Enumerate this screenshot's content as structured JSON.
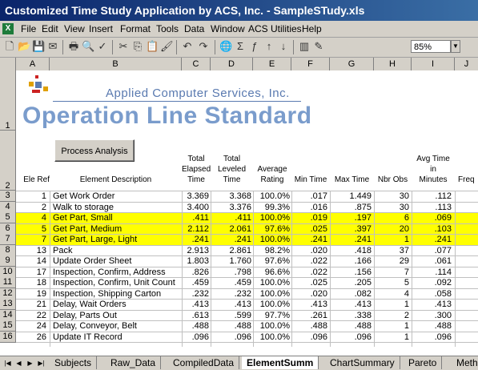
{
  "window": {
    "title": "Customized Time Study Application by ACS, Inc. - SampleSTudy.xls"
  },
  "menu": [
    "File",
    "Edit",
    "View",
    "Insert",
    "Format",
    "Tools",
    "Data",
    "Window",
    "ACS Utilities",
    "Help"
  ],
  "toolbar": {
    "zoom": "85%"
  },
  "columns": [
    "A",
    "B",
    "C",
    "D",
    "E",
    "F",
    "G",
    "H",
    "I",
    "J"
  ],
  "sheet": {
    "company": "Applied Computer Services, Inc.",
    "title": "Operation Line Standard",
    "button_label": "Process Analysis",
    "headers": {
      "ele_ref": "Ele Ref",
      "desc": "Element Description",
      "total_elapsed": "Total Elapsed Time",
      "total_leveled": "Total Leveled Time",
      "avg_rating": "Average Rating",
      "min_time": "Min Time",
      "max_time": "Max Time",
      "nbr_obs": "Nbr Obs",
      "avg_time": "Avg Time in Minutes",
      "freq": "Freq"
    },
    "rows": [
      {
        "row": "3",
        "ref": "1",
        "desc": "Get Work Order",
        "elapsed": "3.369",
        "leveled": "3.368",
        "rating": "100.0%",
        "min": ".017",
        "max": "1.449",
        "obs": "30",
        "avg": ".112",
        "highlight": false
      },
      {
        "row": "4",
        "ref": "2",
        "desc": "Walk to storage",
        "elapsed": "3.400",
        "leveled": "3.376",
        "rating": "99.3%",
        "min": ".016",
        "max": ".875",
        "obs": "30",
        "avg": ".113",
        "highlight": false
      },
      {
        "row": "5",
        "ref": "4",
        "desc": "Get Part, Small",
        "elapsed": ".411",
        "leveled": ".411",
        "rating": "100.0%",
        "min": ".019",
        "max": ".197",
        "obs": "6",
        "avg": ".069",
        "highlight": true
      },
      {
        "row": "6",
        "ref": "5",
        "desc": "Get Part, Medium",
        "elapsed": "2.112",
        "leveled": "2.061",
        "rating": "97.6%",
        "min": ".025",
        "max": ".397",
        "obs": "20",
        "avg": ".103",
        "highlight": true
      },
      {
        "row": "7",
        "ref": "7",
        "desc": "Get Part, Large, Light",
        "elapsed": ".241",
        "leveled": ".241",
        "rating": "100.0%",
        "min": ".241",
        "max": ".241",
        "obs": "1",
        "avg": ".241",
        "highlight": true
      },
      {
        "row": "8",
        "ref": "13",
        "desc": "Pack",
        "elapsed": "2.913",
        "leveled": "2.861",
        "rating": "98.2%",
        "min": ".020",
        "max": ".418",
        "obs": "37",
        "avg": ".077",
        "highlight": false
      },
      {
        "row": "9",
        "ref": "14",
        "desc": "Update Order Sheet",
        "elapsed": "1.803",
        "leveled": "1.760",
        "rating": "97.6%",
        "min": ".022",
        "max": ".166",
        "obs": "29",
        "avg": ".061",
        "highlight": false
      },
      {
        "row": "10",
        "ref": "17",
        "desc": "Inspection, Confirm, Address",
        "elapsed": ".826",
        "leveled": ".798",
        "rating": "96.6%",
        "min": ".022",
        "max": ".156",
        "obs": "7",
        "avg": ".114",
        "highlight": false
      },
      {
        "row": "11",
        "ref": "18",
        "desc": "Inspection, Confirm, Unit Count",
        "elapsed": ".459",
        "leveled": ".459",
        "rating": "100.0%",
        "min": ".025",
        "max": ".205",
        "obs": "5",
        "avg": ".092",
        "highlight": false
      },
      {
        "row": "12",
        "ref": "19",
        "desc": "Inspection, Shipping Carton",
        "elapsed": ".232",
        "leveled": ".232",
        "rating": "100.0%",
        "min": ".020",
        "max": ".082",
        "obs": "4",
        "avg": ".058",
        "highlight": false
      },
      {
        "row": "13",
        "ref": "21",
        "desc": "Delay, Wait Orders",
        "elapsed": ".413",
        "leveled": ".413",
        "rating": "100.0%",
        "min": ".413",
        "max": ".413",
        "obs": "1",
        "avg": ".413",
        "highlight": false
      },
      {
        "row": "14",
        "ref": "22",
        "desc": "Delay, Parts Out",
        "elapsed": ".613",
        "leveled": ".599",
        "rating": "97.7%",
        "min": ".261",
        "max": ".338",
        "obs": "2",
        "avg": ".300",
        "highlight": false
      },
      {
        "row": "15",
        "ref": "24",
        "desc": "Delay, Conveyor, Belt",
        "elapsed": ".488",
        "leveled": ".488",
        "rating": "100.0%",
        "min": ".488",
        "max": ".488",
        "obs": "1",
        "avg": ".488",
        "highlight": false
      },
      {
        "row": "16",
        "ref": "26",
        "desc": "Update IT Record",
        "elapsed": ".096",
        "leveled": ".096",
        "rating": "100.0%",
        "min": ".096",
        "max": ".096",
        "obs": "1",
        "avg": ".096",
        "highlight": false
      }
    ]
  },
  "tabs": [
    "Subjects",
    "Raw_Data",
    "CompiledData",
    "ElementSumm",
    "ChartSummary",
    "Pareto",
    "Meth"
  ],
  "active_tab": "ElementSumm"
}
